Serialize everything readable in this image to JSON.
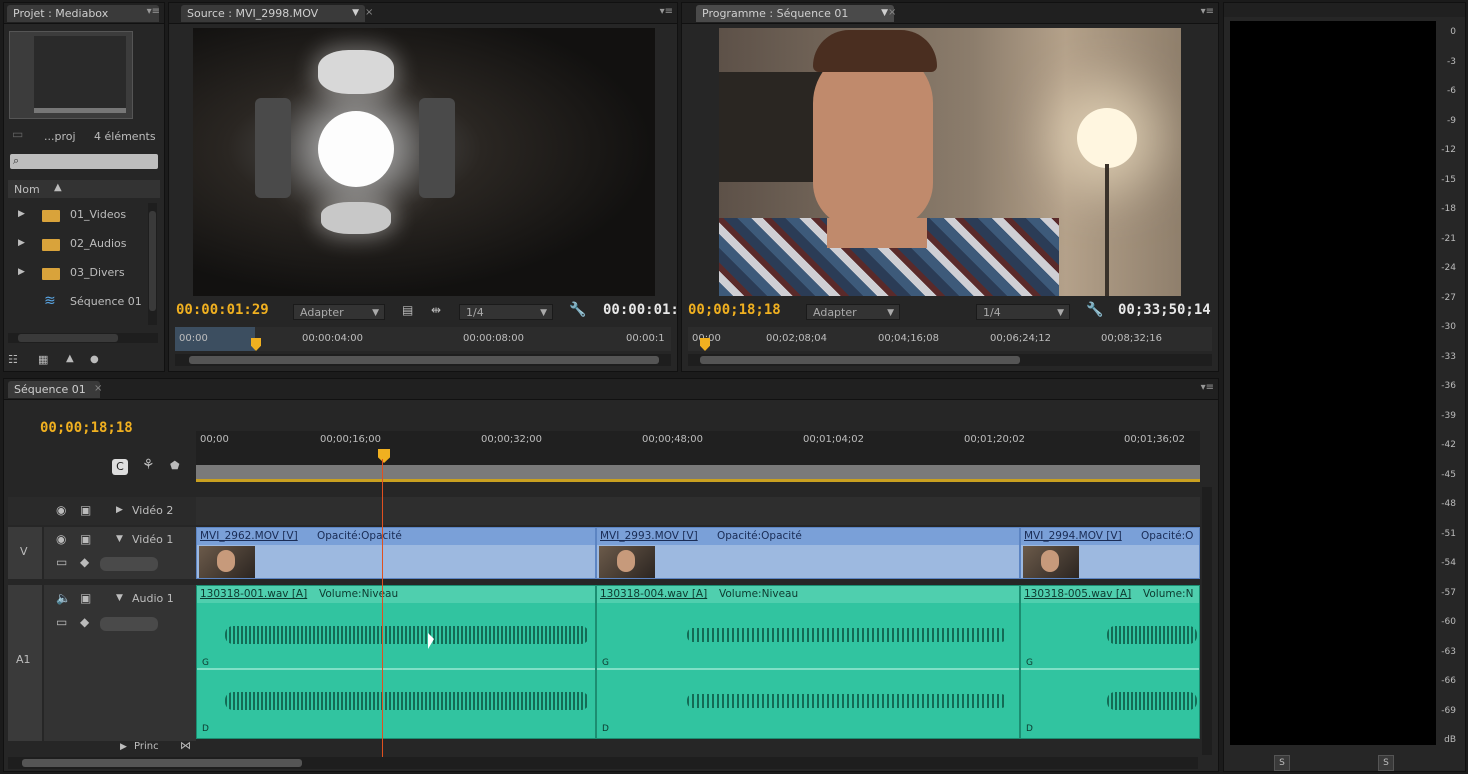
{
  "project": {
    "tab": "Projet : Mediabox",
    "name": "...proj",
    "count": "4 éléments",
    "column_header": "Nom",
    "items": [
      {
        "label": "01_Videos",
        "icon": "folder-icon"
      },
      {
        "label": "02_Audios",
        "icon": "folder-icon"
      },
      {
        "label": "03_Divers",
        "icon": "folder-icon"
      },
      {
        "label": "Séquence 01",
        "icon": "sequence-icon"
      }
    ]
  },
  "source": {
    "tab": "Source : MVI_2998.MOV",
    "timecode": "00:00:01:29",
    "fit": "Adapter",
    "resolution": "1/4",
    "duration": "00:00:01:",
    "ruler": [
      "00:00",
      "00:00:04:00",
      "00:00:08:00",
      "00:00:1"
    ]
  },
  "program": {
    "tab": "Programme : Séquence 01",
    "timecode": "00;00;18;18",
    "fit": "Adapter",
    "resolution": "1/4",
    "duration": "00;33;50;14",
    "ruler": [
      "00;00",
      "00;02;08;04",
      "00;04;16;08",
      "00;06;24;12",
      "00;08;32;16"
    ]
  },
  "timeline": {
    "tab": "Séquence 01",
    "timecode": "00;00;18;18",
    "ruler": [
      "00;00",
      "00;00;16;00",
      "00;00;32;00",
      "00;00;48;00",
      "00;01;04;02",
      "00;01;20;02",
      "00;01;36;02"
    ],
    "tracks": {
      "video2": "Vidéo 2",
      "video1": "Vidéo 1",
      "audio1": "Audio 1",
      "v_label": "V",
      "a_label": "A1",
      "master": "Princ"
    },
    "video_clips": [
      {
        "name": "MVI_2962.MOV [V]",
        "effect": "Opacité:Opacité"
      },
      {
        "name": "MVI_2993.MOV [V]",
        "effect": "Opacité:Opacité"
      },
      {
        "name": "MVI_2994.MOV [V]",
        "effect": "Opacité:O"
      }
    ],
    "audio_clips": [
      {
        "name": "130318-001.wav [A]",
        "effect": "Volume:Niveau"
      },
      {
        "name": "130318-004.wav [A]",
        "effect": "Volume:Niveau"
      },
      {
        "name": "130318-005.wav [A]",
        "effect": "Volume:N"
      }
    ],
    "channel_left": "G",
    "channel_right": "D"
  },
  "meter": {
    "ticks": [
      "0",
      "-3",
      "-6",
      "-9",
      "-12",
      "-15",
      "-18",
      "-21",
      "-24",
      "-27",
      "-30",
      "-33",
      "-36",
      "-39",
      "-42",
      "-45",
      "-48",
      "-51",
      "-54",
      "-57",
      "-60",
      "-63",
      "-66",
      "-69",
      "dB"
    ],
    "solo_left": "S",
    "solo_right": "S"
  },
  "colors": {
    "timecode": "#f0b020",
    "video_clip": "#9db9e0",
    "audio_clip": "#31c4a0",
    "playhead": "#e05020"
  }
}
